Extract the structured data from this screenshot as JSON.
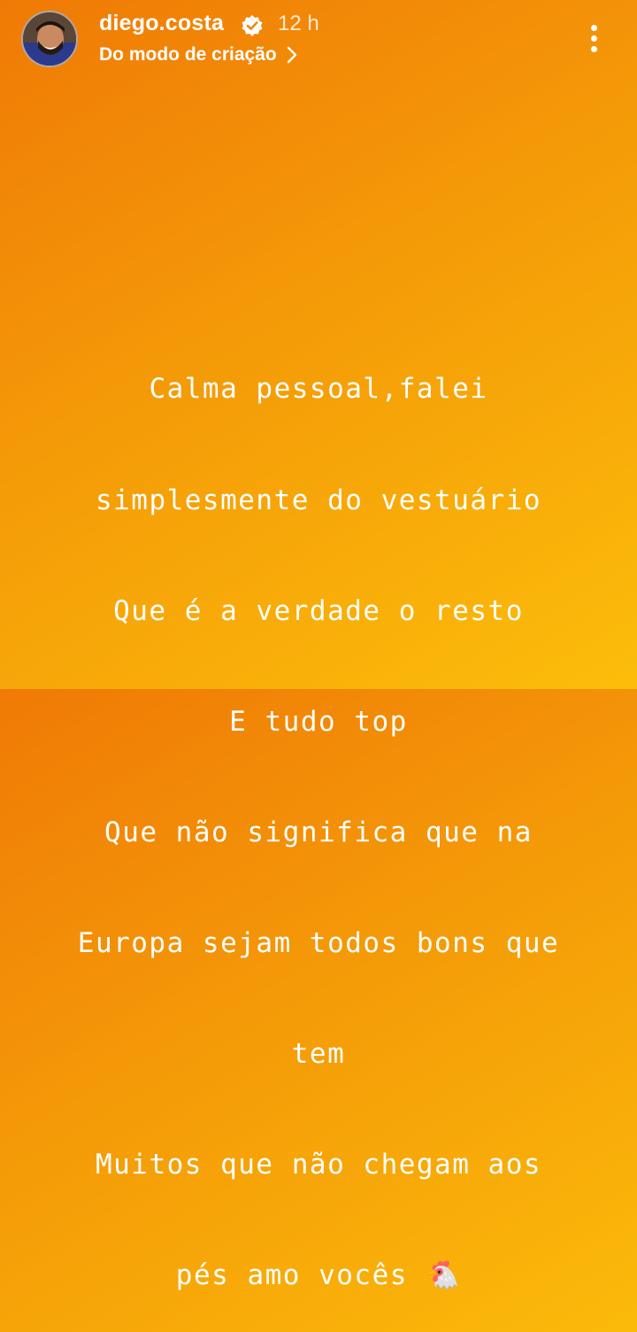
{
  "header": {
    "username": "diego.costa",
    "time": "12 h",
    "creation_link": "Do modo de criação"
  },
  "story": {
    "lines": [
      "Calma pessoal,falei",
      "simplesmente do vestuário",
      "Que é a verdade o resto",
      "E tudo top",
      "Que não significa que na",
      "Europa sejam todos bons que",
      "tem",
      "Muitos que não chegam aos",
      "pés amo vocês 🐔"
    ]
  },
  "colors": {
    "gradient_start": "#f07a06",
    "gradient_end": "#fcbd0a",
    "text": "#ffffff"
  },
  "icons": [
    "verified-badge-icon",
    "chevron-right-icon",
    "more-options-icon"
  ]
}
